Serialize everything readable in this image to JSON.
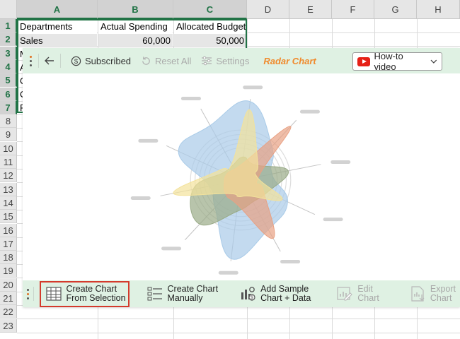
{
  "sheet": {
    "columns": [
      "A",
      "B",
      "C",
      "D",
      "E",
      "F",
      "G",
      "H"
    ],
    "rows": [
      "1",
      "2",
      "3",
      "4",
      "5",
      "6",
      "7",
      "8",
      "9",
      "10",
      "11",
      "12",
      "13",
      "14",
      "15",
      "16",
      "17",
      "18",
      "19",
      "20",
      "21",
      "22",
      "23"
    ],
    "cells": {
      "a1": "Departments",
      "b1": "Actual Spending",
      "c1": "Allocated Budget",
      "a2": "Sales",
      "b2": "60,000",
      "c2": "50,000",
      "a3": "M",
      "a4": "A",
      "a5": "C",
      "a6": "C",
      "a7": "R"
    }
  },
  "toolbar": {
    "subscribed_label": "Subscribed",
    "reset_label": "Reset All",
    "settings_label": "Settings",
    "title": "Radar Chart",
    "howto_label": "How-to video"
  },
  "bottombar": {
    "create_from_selection_line1": "Create Chart",
    "create_from_selection_line2": "From Selection",
    "create_manually_line1": "Create Chart",
    "create_manually_line2": "Manually",
    "add_sample_line1": "Add Sample",
    "add_sample_line2": "Chart + Data",
    "edit_chart_line1": "Edit",
    "edit_chart_line2": "Chart",
    "export_chart_line1": "Export",
    "export_chart_line2": "Chart"
  },
  "chart_data": {
    "type": "radar",
    "series": [
      {
        "color": "#a9cbe8",
        "values": [
          0.95,
          0.55,
          0.38,
          0.62,
          0.68,
          0.95,
          0.45,
          0.38,
          0.82,
          0.75
        ]
      },
      {
        "color": "#9aab88",
        "values": [
          0.28,
          0.25,
          0.58,
          0.35,
          0.3,
          0.38,
          0.72,
          0.58,
          0.22,
          0.2
        ]
      },
      {
        "color": "#e8a183",
        "values": [
          0.2,
          0.88,
          0.22,
          0.3,
          0.8,
          0.3,
          0.25,
          0.2,
          0.18,
          0.15
        ]
      },
      {
        "color": "#f3e29b",
        "values": [
          0.85,
          0.3,
          0.2,
          0.55,
          0.22,
          0.2,
          0.22,
          0.82,
          0.28,
          0.22
        ]
      }
    ],
    "grid_rings": 5
  },
  "colors": {
    "accent_green": "#217346",
    "panel_bar": "#dff1e3",
    "title_orange": "#f08a2c",
    "highlight_red": "#d43a2c"
  }
}
